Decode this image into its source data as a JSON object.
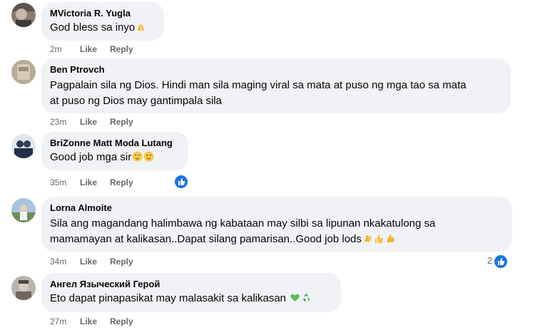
{
  "comments": [
    {
      "author": "MVictoria R. Yugla",
      "text": "God bless sa inyo",
      "emoji": [
        "folded-hands-emoji"
      ],
      "time": "2m",
      "like_label": "Like",
      "reply_label": "Reply"
    },
    {
      "author": "Ben Ptrovch",
      "text_line1": "Pagpalain sila ng Dios. Hindi man sila maging viral sa mata at puso ng mga tao sa mata",
      "text_line2": "at puso ng Dios may gantimpala sila",
      "time": "23m",
      "like_label": "Like",
      "reply_label": "Reply"
    },
    {
      "author": "BriZonne Matt Moda Lutang",
      "text": "Good job mga sir",
      "emoji": [
        "relieved-face-emoji",
        "relieved-face-emoji"
      ],
      "time": "35m",
      "like_label": "Like",
      "reply_label": "Reply",
      "reaction": "like-reaction-icon"
    },
    {
      "author": "Lorna Almoite",
      "text_line1": "Sila ang magandang halimbawa ng kabataan may silbi sa lipunan nkakatulong sa",
      "text_line2": "mamamayan at kalikasan..Dapat silang pamarisan..Good job lods",
      "emoji": [
        "clapping-hands-emoji",
        "thumbs-up-emoji",
        "flexed-biceps-emoji"
      ],
      "time": "34m",
      "like_label": "Like",
      "reply_label": "Reply",
      "reaction_count": "2",
      "reaction": "like-reaction-icon"
    },
    {
      "author": "Ангел Языческий Герой",
      "text": "Eto dapat pinapasikat may malasakit sa kalikasan",
      "emoji": [
        "green-heart-emoji",
        "recycle-emoji"
      ],
      "time": "27m",
      "like_label": "Like",
      "reply_label": "Reply"
    }
  ],
  "colors": {
    "bubble": "#f0f2f5",
    "meta": "#65676b",
    "like_blue": "#1b74e4"
  }
}
